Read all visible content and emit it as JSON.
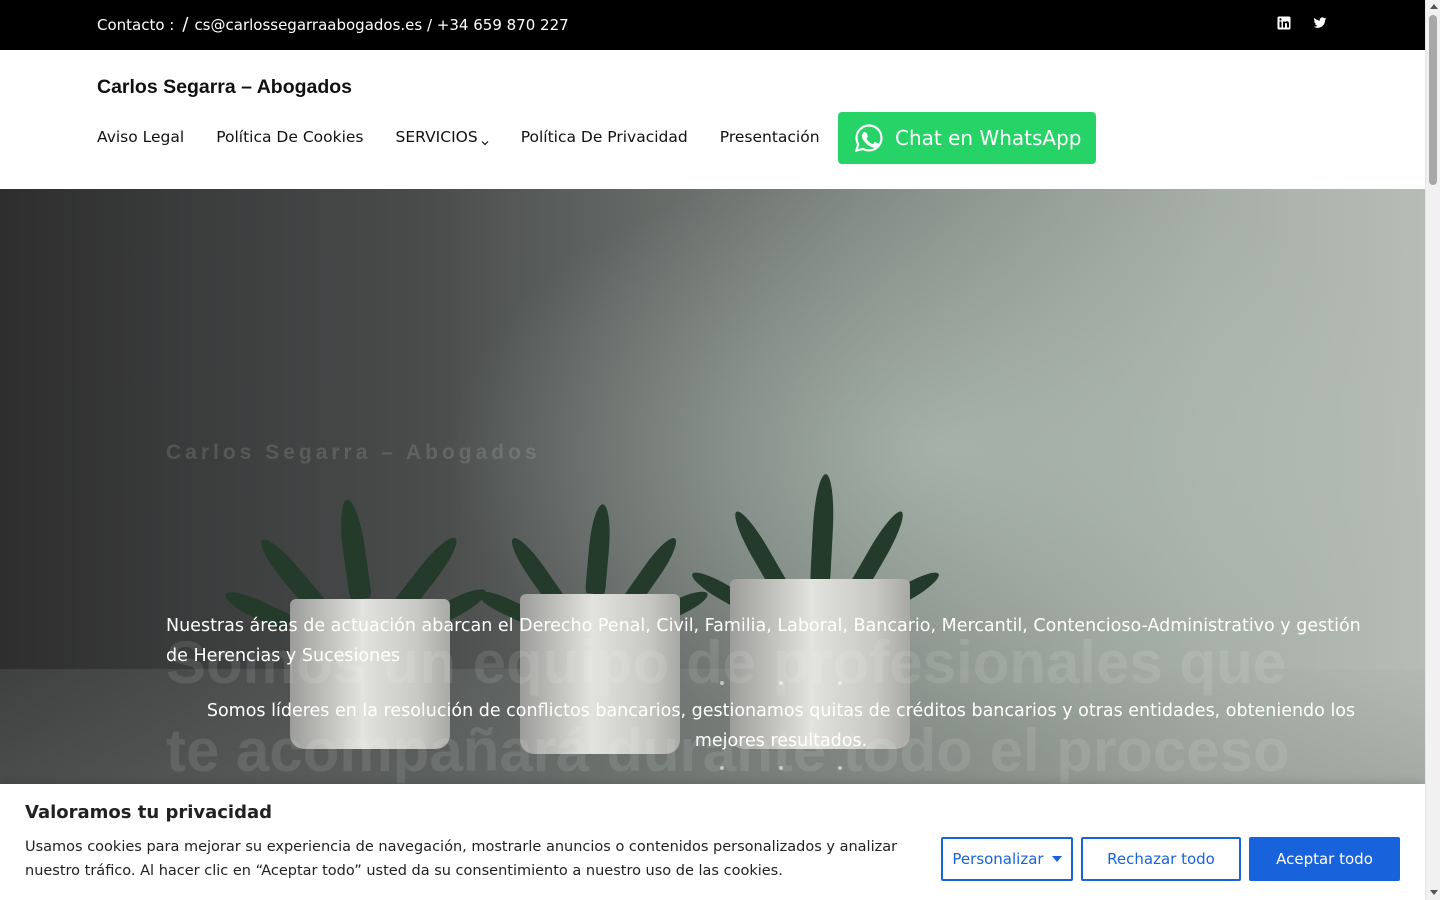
{
  "topbar": {
    "contact_label": "Contacto :",
    "separator": "/",
    "email_phone": "cs@carlossegarraabogados.es / +34 659 870 227",
    "social_icons": [
      "linkedin-icon",
      "twitter-icon"
    ]
  },
  "header": {
    "site_title": "Carlos Segarra – Abogados",
    "nav": [
      {
        "label": "Aviso Legal"
      },
      {
        "label": "Política De Cookies"
      },
      {
        "label": "SERVICIOS",
        "has_dropdown": true
      },
      {
        "label": "Política De Privacidad"
      },
      {
        "label": "Presentación"
      }
    ],
    "whatsapp_label": "Chat en WhatsApp",
    "whatsapp_color": "#25d366"
  },
  "hero": {
    "kicker": "Carlos Segarra – Abogados",
    "headline": "Somos un equipo de profesionales que te acompañará durante todo el proceso jurídico",
    "paragraph_1": "Nuestras áreas de actuación abarcan el Derecho Penal, Civil, Familia, Laboral, Bancario, Mercantil, Contencioso-Administrativo y gestión de Herencias y Sucesiones",
    "paragraph_2": "Somos líderes en la resolución de conflictos bancarios, gestionamos quitas de créditos bancarios y otras entidades, obteniendo los mejores resultados."
  },
  "cookie_banner": {
    "title": "Valoramos tu privacidad",
    "text": "Usamos cookies para mejorar su experiencia de navegación, mostrarle anuncios o contenidos personalizados y analizar nuestro tráfico. Al hacer clic en “Aceptar todo” usted da su consentimiento a nuestro uso de las cookies.",
    "customize_label": "Personalizar",
    "reject_label": "Rechazar todo",
    "accept_label": "Aceptar todo",
    "accent_color": "#1863dc"
  }
}
